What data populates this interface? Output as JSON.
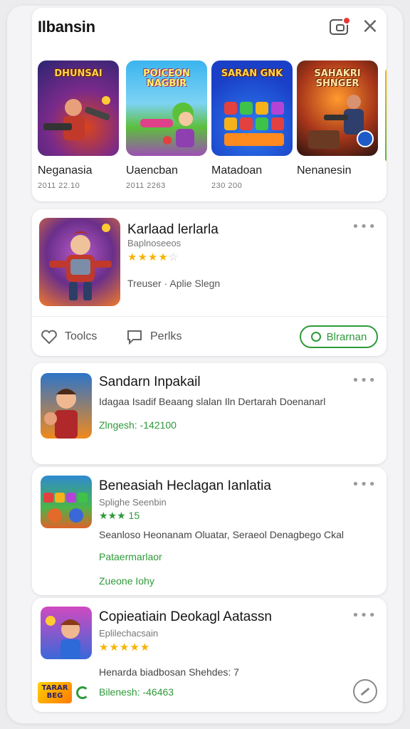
{
  "header": {
    "title": "Ilbansin",
    "tiles": [
      {
        "name": "Neganasia",
        "meta": "2011 22.10",
        "art_title": "DHUNSAI",
        "bg": [
          "#3a2a8c",
          "#c83b1e"
        ]
      },
      {
        "name": "Uaencban",
        "meta": "2011 2263",
        "art_title": "POICEON NAGBIR",
        "bg": [
          "#2aa7e8",
          "#5fbf3a"
        ]
      },
      {
        "name": "Matadoan",
        "meta": "230 200",
        "art_title": "SARAN GNK",
        "bg": [
          "#1f5be0",
          "#e0842a"
        ]
      },
      {
        "name": "Nenanesin",
        "meta": "",
        "art_title": "SAHAKRI SHNGER",
        "bg": [
          "#ff8a1e",
          "#3a1a12"
        ]
      }
    ]
  },
  "featured": {
    "title": "Karlaad lerlarla",
    "subtitle": "Baplnoseeos",
    "rating": 4,
    "rating_max": 5,
    "info": "Treuser · Aplie Slegn",
    "action1": "Toolcs",
    "action2": "Perlks",
    "button": "Blrarnan"
  },
  "items": [
    {
      "title": "Sandarn Inpakail",
      "desc": "Idagaa Isadif Beaang slalan Iln Dertarah Doenanarl",
      "green1": "Zlngesh: -142100",
      "green2": ""
    },
    {
      "title": "Beneasiah Heclagan Ianlatia",
      "sub": "Splighe Seenbin",
      "rating_text": "★★★ 15",
      "desc": "Seanloso Heonanam Oluatar, Seraeol Denagbego Ckal",
      "green1": "Pataermarlaor",
      "green2": "Zueone Iohy"
    },
    {
      "title": "Copieatiain Deokagl Aatassn",
      "sub": "Eplilechacsain",
      "rating": 5,
      "desc": "Henarda biadbosan Shehdes: 7",
      "green1": "Bilenesh: -46463",
      "logo_text": "TARAR BEG"
    }
  ],
  "colors": {
    "accent": "#2e9a3a",
    "star": "#f5b400",
    "notif": "#e53935"
  }
}
